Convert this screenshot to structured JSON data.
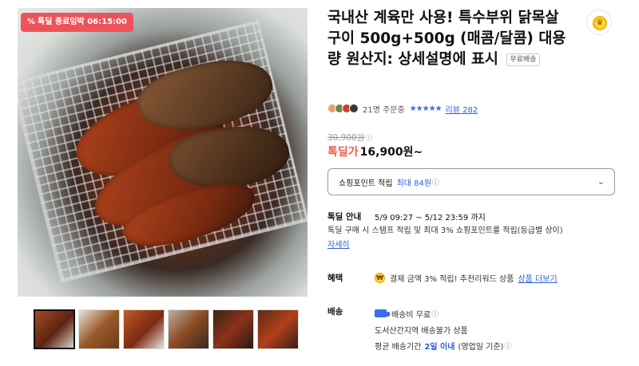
{
  "badge": {
    "icon": "percent-icon",
    "text": "톡딜 종료임박 06:15:00",
    "color": "#f0525a"
  },
  "product": {
    "title": "국내산 계육만 사용! 특수부위 닭목살구이 500g+500g (매콤/달콤) 대용량 원산지: 상세설명에 표시",
    "free_shipping_tag": "무료배송"
  },
  "meta": {
    "orders": "21명 주문중",
    "rating_stars": "★★★★★",
    "reviews": "리뷰 282",
    "star_color": "#3a6ee8"
  },
  "price": {
    "original": "30,900원",
    "original_info": "ⓘ",
    "sale_label": "톡딜가",
    "sale_price": "16,900원~",
    "sale_color": "#f15a45"
  },
  "points": {
    "label": "쇼핑포인트 적립",
    "highlight": "최대 84원",
    "info": "ⓘ",
    "chevron": "⌄"
  },
  "deal": {
    "label": "톡딜 안내",
    "period": "5/9 09:27 ~ 5/12 23:59 까지",
    "description": "톡딜 구매 시 스탬프 적립 및 최대 3% 쇼핑포인트를 적립(등급별 상이)",
    "more_link": "자세히"
  },
  "benefit": {
    "label": "혜택",
    "coin": "₩",
    "text": "결제 금액 3% 적립! 추천리워드 상품",
    "link": "상품 더보기"
  },
  "shipping": {
    "label": "배송",
    "fee": "배송비 무료",
    "fee_info": "ⓘ",
    "region": "도서산간지역 배송불가 상품",
    "avg_prefix": "평균 배송기간",
    "avg_days": "2일 이내",
    "avg_suffix": "(영업일 기준)",
    "avg_info": "ⓘ"
  },
  "share": {
    "icon": "crown-coin-icon",
    "glyph": "♛"
  },
  "accent_blue": "#2a5fd8"
}
